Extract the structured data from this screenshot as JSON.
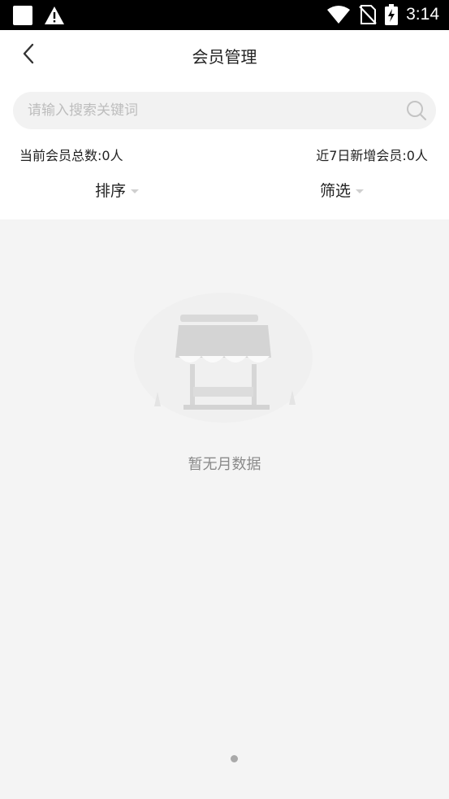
{
  "status_bar": {
    "time": "3:14",
    "icons": [
      "notification-square-icon",
      "warning-icon",
      "wifi-icon",
      "no-sim-icon",
      "battery-charging-icon"
    ]
  },
  "nav": {
    "title": "会员管理",
    "back_icon": "chevron-left-icon"
  },
  "search": {
    "placeholder": "请输入搜索关键词",
    "value": "",
    "icon": "search-icon"
  },
  "stats": {
    "total_members": "当前会员总数:0人",
    "new_members_7d": "近7日新增会员:0人"
  },
  "filters": {
    "sort_label": "排序",
    "filter_label": "筛选"
  },
  "empty_state": {
    "icon": "storefront-icon",
    "message": "暂无月数据"
  },
  "colors": {
    "background": "#f4f4f4",
    "header_bg": "#ffffff",
    "search_bg": "#f2f2f2",
    "text_primary": "#222222",
    "text_muted": "#8a8a8a",
    "placeholder": "#bdbdbd"
  }
}
